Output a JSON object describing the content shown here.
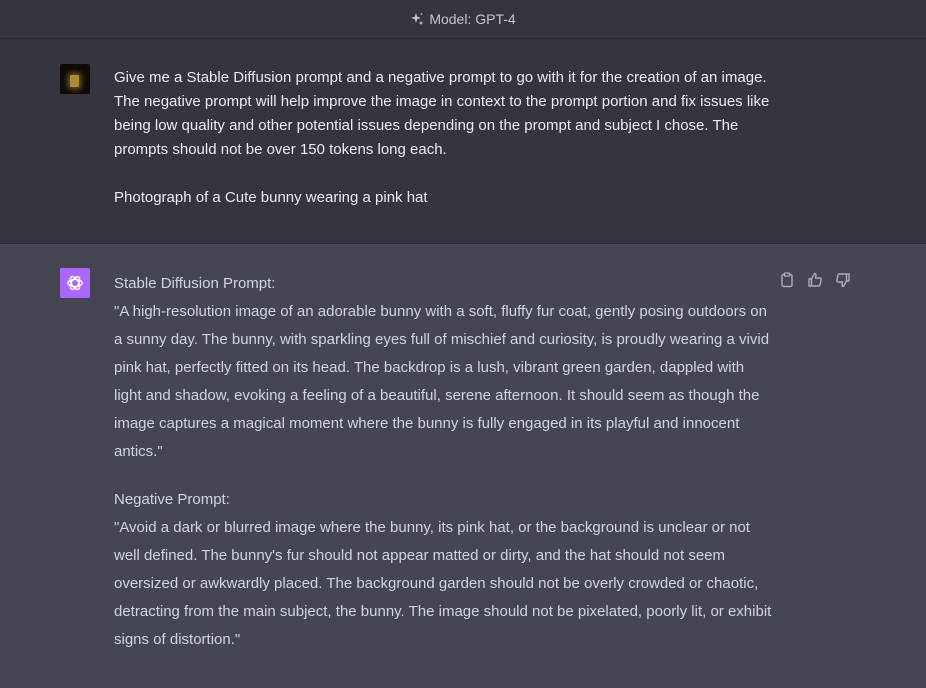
{
  "header": {
    "model_label": "Model: GPT-4",
    "icon": "sparkle-icon"
  },
  "user_message": {
    "avatar": "user-avatar",
    "paragraph_1": "Give me a Stable Diffusion prompt and a negative prompt to go with it for the creation of an image. The negative prompt will help improve the image in context to the prompt portion and fix issues like being low quality and other potential issues depending on the prompt and subject I chose. The prompts should not be over 150 tokens long each.",
    "paragraph_2": "Photograph of a Cute bunny wearing a pink hat"
  },
  "assistant_message": {
    "avatar": "openai-logo-icon",
    "prompt_label": "Stable Diffusion Prompt:",
    "prompt_text": "\"A high-resolution image of an adorable bunny with a soft, fluffy fur coat, gently posing outdoors on a sunny day. The bunny, with sparkling eyes full of mischief and curiosity, is proudly wearing a vivid pink hat, perfectly fitted on its head. The backdrop is a lush, vibrant green garden, dappled with light and shadow, evoking a feeling of a beautiful, serene afternoon. It should seem as though the image captures a magical moment where the bunny is fully engaged in its playful and innocent antics.\"",
    "negative_label": "Negative Prompt:",
    "negative_text": "\"Avoid a dark or blurred image where the bunny, its pink hat, or the background is unclear or not well defined. The bunny's fur should not appear matted or dirty, and the hat should not seem oversized or awkwardly placed. The background garden should not be overly crowded or chaotic, detracting from the main subject, the bunny. The image should not be pixelated, poorly lit, or exhibit signs of distortion.\"",
    "actions": [
      "clipboard-icon",
      "thumbs-up-icon",
      "thumbs-down-icon"
    ]
  },
  "colors": {
    "user_bg": "#343541",
    "assistant_bg": "#444654",
    "gpt4_avatar": "#ab68ff",
    "text": "#ececf1"
  }
}
